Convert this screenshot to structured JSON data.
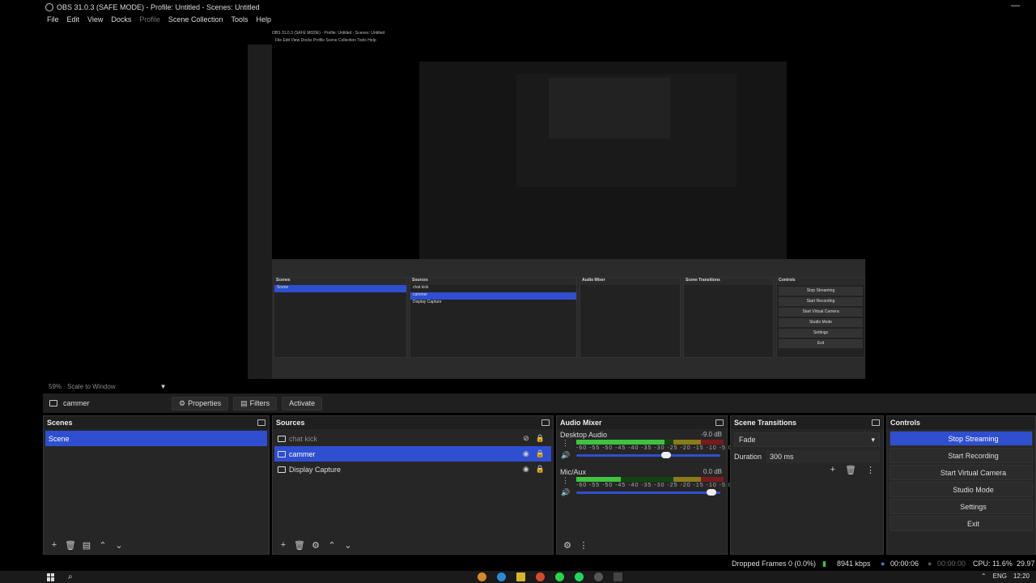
{
  "window": {
    "title": "OBS 31.0.3 (SAFE MODE) - Profile: Untitled - Scenes: Untitled",
    "minimize": "—"
  },
  "menu": [
    "File",
    "Edit",
    "View",
    "Docks",
    "Profile",
    "Scene Collection",
    "Tools",
    "Help"
  ],
  "preview": {
    "inner_title": "OBS 31.0.3 (SAFE MODE) - Profile: Untitled - Scenes: Untitled",
    "inner_menu": "File  Edit  View  Docks  Profile  Scene Collection  Tools  Help"
  },
  "zoom": {
    "percent": "59%",
    "mode": "Scale to Window",
    "dropdown": "▼"
  },
  "source_toolbar": {
    "source_name": "cammer",
    "properties": "Properties",
    "filters": "Filters",
    "activate": "Activate"
  },
  "scenes": {
    "title": "Scenes",
    "items": [
      {
        "label": "Scene",
        "selected": true
      }
    ]
  },
  "sources": {
    "title": "Sources",
    "items": [
      {
        "label": "chat kick",
        "icon": "camera-icon",
        "hidden": true
      },
      {
        "label": "cammer",
        "icon": "camera-icon",
        "selected": true
      },
      {
        "label": "Display Capture",
        "icon": "monitor-icon"
      }
    ]
  },
  "mixer": {
    "title": "Audio Mixer",
    "channels": [
      {
        "name": "Desktop Audio",
        "db": "-9.0 dB",
        "level_fraction": 0.6,
        "volume_fraction": 0.66
      },
      {
        "name": "Mic/Aux",
        "db": "0.0 dB",
        "level_fraction": 0.3,
        "volume_fraction": 0.97
      }
    ],
    "ticks": "-60 -55 -50 -45 -40 -35 -30 -25 -20 -15 -10 -5 0"
  },
  "transitions": {
    "title": "Scene Transitions",
    "selected": "Fade",
    "duration_label": "Duration",
    "duration_value": "300 ms"
  },
  "controls": {
    "title": "Controls",
    "buttons": [
      "Stop Streaming",
      "Start Recording",
      "Start Virtual Camera",
      "Studio Mode",
      "Settings",
      "Exit"
    ]
  },
  "status": {
    "dropped": "Dropped Frames 0 (0.0%)",
    "bitrate": "8941 kbps",
    "stream_time": "00:00:06",
    "rec_time": "00:00:00",
    "cpu": "CPU: 11.6%",
    "fps": "29.97"
  },
  "taskbar": {
    "lang": "ENG",
    "time": "12:20"
  },
  "colors": {
    "accent": "#2f4fd0",
    "panel": "#262626",
    "background": "#000000"
  }
}
